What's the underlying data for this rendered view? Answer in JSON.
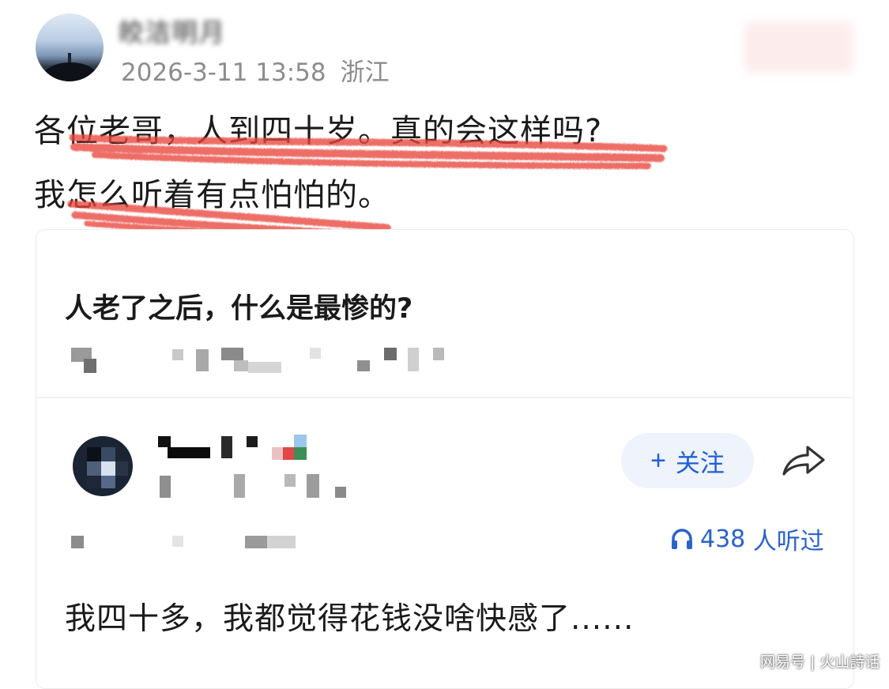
{
  "post": {
    "author_name": "皎洁明月",
    "timestamp": "2026-3-11 13:58",
    "location": "浙江",
    "text_line1": "各位老哥，人到四十岁。真的会这样吗?",
    "text_line2": "我怎么听着有点怕怕的。",
    "highlight_color": "#e8453c"
  },
  "shared_card": {
    "question": "人老了之后，什么是最惨的?",
    "follow_button": {
      "icon": "plus-icon",
      "label": "关注"
    },
    "share_icon": "share-arrow-icon",
    "listen": {
      "icon": "headphones-icon",
      "count": "438",
      "suffix": "人听过"
    },
    "answer_text": "我四十多，我都觉得花钱没啥快感了......",
    "accent_color": "#1f5fd6"
  },
  "watermark": "网易号 | 火山詩话"
}
